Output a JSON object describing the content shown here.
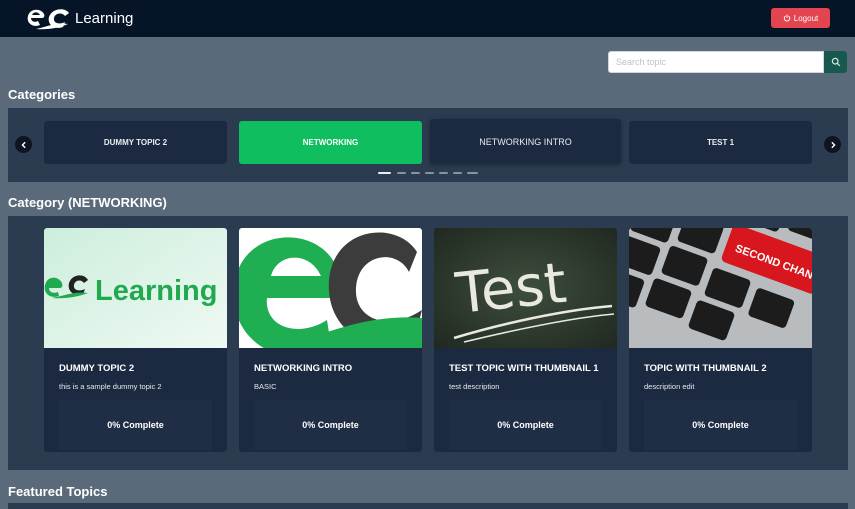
{
  "header": {
    "brand": "Learning",
    "logo_icon": "ec-logo-icon",
    "logout_label": "Logout",
    "logout_icon": "logout-icon"
  },
  "search": {
    "placeholder": "Search topic",
    "value": "",
    "icon": "search-icon"
  },
  "categories": {
    "title": "Categories",
    "items": [
      {
        "label": "DUMMY TOPIC 2",
        "active": false
      },
      {
        "label": "NETWORKING",
        "active": true
      },
      {
        "label": "NETWORKING INTRO",
        "active": false
      },
      {
        "label": "TEST 1",
        "active": false
      }
    ],
    "pagination_dots": 7,
    "active_dot": 0
  },
  "category_section": {
    "title": "Category (NETWORKING)",
    "topics": [
      {
        "title": "DUMMY TOPIC 2",
        "description": "this is a sample dummy topic 2",
        "progress": "0% Complete",
        "thumbnail": "ec-learning-logo-image",
        "thumb_text": "Learning"
      },
      {
        "title": "NETWORKING INTRO",
        "description": "BASIC",
        "progress": "0% Complete",
        "thumbnail": "ec-logo-closeup-image"
      },
      {
        "title": "TEST TOPIC WITH THUMBNAIL 1",
        "description": "test description",
        "progress": "0% Complete",
        "thumbnail": "chalkboard-test-image",
        "thumb_text": "Test"
      },
      {
        "title": "TOPIC WITH THUMBNAIL 2",
        "description": "description edit",
        "progress": "0% Complete",
        "thumbnail": "second-chance-keyboard-image",
        "thumb_text": "SECOND CHANCE"
      }
    ]
  },
  "featured": {
    "title": "Featured Topics"
  },
  "colors": {
    "header_bg": "#061428",
    "page_bg": "#5b6a7b",
    "panel_bg": "#2c3c50",
    "card_bg": "#1b2a40",
    "accent_green": "#0fbf5f",
    "logout_red": "#e2454f",
    "search_btn": "#17594f"
  }
}
